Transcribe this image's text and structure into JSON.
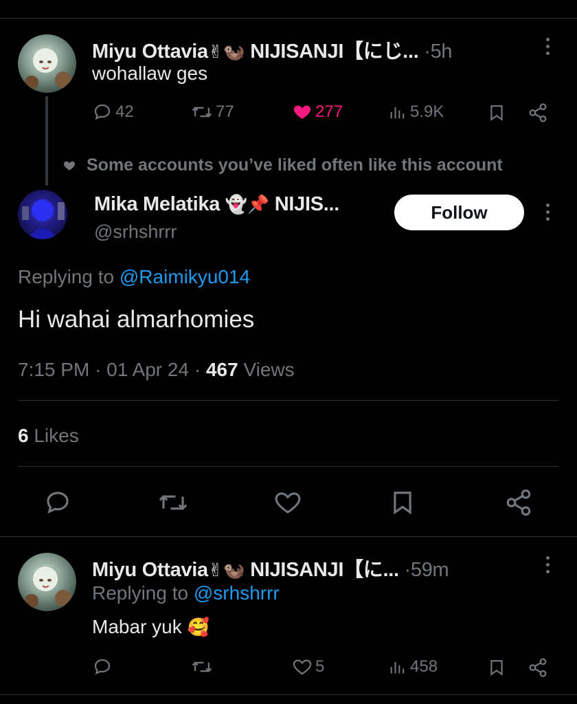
{
  "tweet1": {
    "author_name": "Miyu Ottavia",
    "emoji1": "✌",
    "emoji2": "🦦",
    "affiliation": "NIJISANJI【にじ...",
    "sep": "·",
    "time": "5h",
    "text": "wohallaw ges",
    "replies": "42",
    "retweets": "77",
    "likes": "277",
    "views": "5.9K"
  },
  "social_context": "Some accounts you’ve liked often like this account",
  "main_tweet": {
    "author_name": "Mika Melatika",
    "emoji1": "👻",
    "emoji2": "📌",
    "affiliation": "NIJIS...",
    "handle": "@srhshrrr",
    "follow_label": "Follow",
    "replying_prefix": "Replying to",
    "replying_to": "@Raimikyu014",
    "text": "Hi wahai almarhomies",
    "time": "7:15 PM",
    "date": "01 Apr 24",
    "sep": "·",
    "views_count": "467",
    "views_label": "Views",
    "likes_count": "6",
    "likes_label": "Likes"
  },
  "reply": {
    "author_name": "Miyu Ottavia",
    "emoji1": "✌",
    "emoji2": "🦦",
    "affiliation": "NIJISANJI【に...",
    "sep": "·",
    "time": "59m",
    "replying_prefix": "Replying to",
    "replying_to": "@srhshrrr",
    "text": "Mabar yuk",
    "text_emoji": "🥰",
    "likes": "5",
    "views": "458"
  },
  "colors": {
    "background": "#000000",
    "text": "#e7e9ea",
    "muted": "#71767b",
    "link": "#1d9bf0",
    "like_active": "#f91880"
  }
}
